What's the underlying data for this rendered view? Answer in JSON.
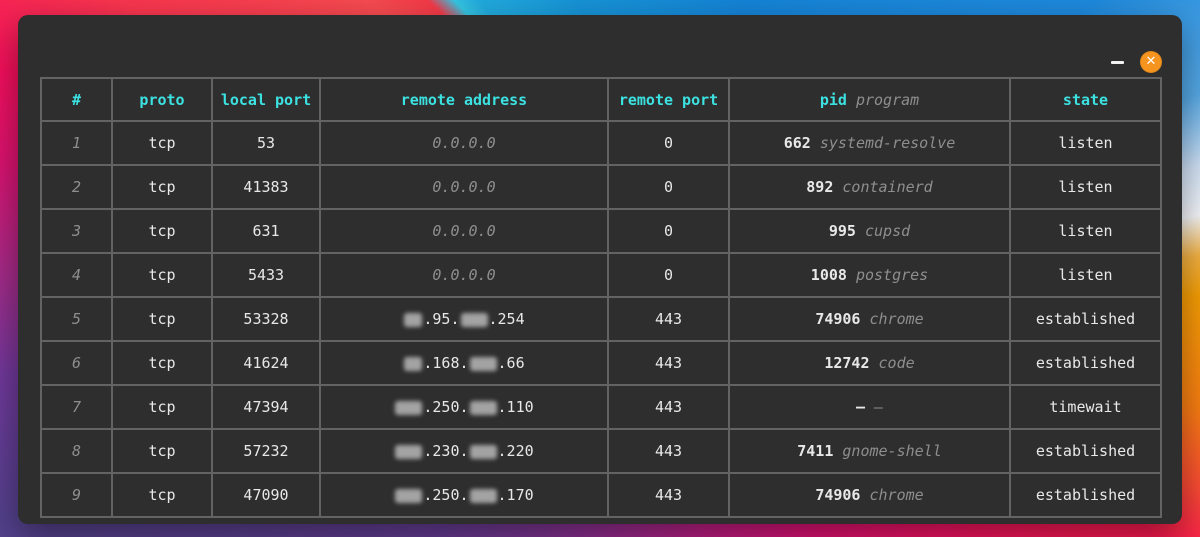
{
  "colors": {
    "window_bg": "#2e2e2e",
    "grid": "#636363",
    "accent": "#3ce1e1",
    "text": "#e8e8e8",
    "muted": "#8e8e8e",
    "close_bg": "#f5941e"
  },
  "window": {
    "controls": {
      "close_glyph": "✕"
    }
  },
  "table": {
    "columns": [
      {
        "key": "num",
        "label": "#"
      },
      {
        "key": "proto",
        "label": "proto"
      },
      {
        "key": "local_port",
        "label": "local port"
      },
      {
        "key": "remote_address",
        "label": "remote address"
      },
      {
        "key": "remote_port",
        "label": "remote port"
      },
      {
        "key": "pid",
        "label": "pid",
        "sublabel": "program"
      },
      {
        "key": "state",
        "label": "state"
      }
    ],
    "rows": [
      {
        "num": "1",
        "proto": "tcp",
        "local_port": "53",
        "remote_address": "0.0.0.0",
        "address_muted": true,
        "remote_port": "0",
        "pid": "662",
        "program": "systemd-resolve",
        "state": "listen"
      },
      {
        "num": "2",
        "proto": "tcp",
        "local_port": "41383",
        "remote_address": "0.0.0.0",
        "address_muted": true,
        "remote_port": "0",
        "pid": "892",
        "program": "containerd",
        "state": "listen"
      },
      {
        "num": "3",
        "proto": "tcp",
        "local_port": "631",
        "remote_address": "0.0.0.0",
        "address_muted": true,
        "remote_port": "0",
        "pid": "995",
        "program": "cupsd",
        "state": "listen"
      },
      {
        "num": "4",
        "proto": "tcp",
        "local_port": "5433",
        "remote_address": "0.0.0.0",
        "address_muted": true,
        "remote_port": "0",
        "pid": "1008",
        "program": "postgres",
        "state": "listen"
      },
      {
        "num": "5",
        "proto": "tcp",
        "local_port": "53328",
        "remote_address": "██.95.███.254",
        "address_muted": false,
        "remote_port": "443",
        "pid": "74906",
        "program": "chrome",
        "state": "established"
      },
      {
        "num": "6",
        "proto": "tcp",
        "local_port": "41624",
        "remote_address": "██.168.███.66",
        "address_muted": false,
        "remote_port": "443",
        "pid": "12742",
        "program": "code",
        "state": "established"
      },
      {
        "num": "7",
        "proto": "tcp",
        "local_port": "47394",
        "remote_address": "███.250.███.110",
        "address_muted": false,
        "remote_port": "443",
        "pid": "–",
        "program": "–",
        "state": "timewait"
      },
      {
        "num": "8",
        "proto": "tcp",
        "local_port": "57232",
        "remote_address": "███.230.███.220",
        "address_muted": false,
        "remote_port": "443",
        "pid": "7411",
        "program": "gnome-shell",
        "state": "established"
      },
      {
        "num": "9",
        "proto": "tcp",
        "local_port": "47090",
        "remote_address": "███.250.███.170",
        "address_muted": false,
        "remote_port": "443",
        "pid": "74906",
        "program": "chrome",
        "state": "established"
      }
    ]
  }
}
